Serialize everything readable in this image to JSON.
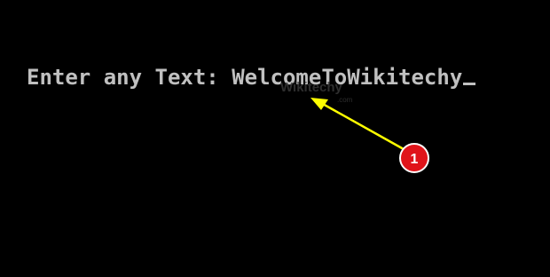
{
  "console": {
    "prompt": "Enter any Text: ",
    "input": "WelcomeToWikitechy"
  },
  "watermark": {
    "brand": "Wikitechy",
    "domain": ".com"
  },
  "annotation": {
    "marker_label": "1",
    "arrow_color": "#ffff00",
    "badge_color": "#e0141a"
  }
}
